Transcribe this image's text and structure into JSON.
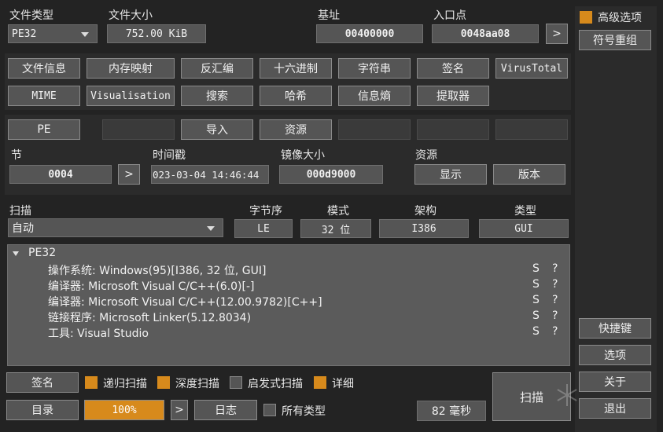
{
  "header": {
    "file_type_label": "文件类型",
    "file_type_value": "PE32",
    "file_size_label": "文件大小",
    "file_size_value": "752.00 KiB",
    "base_label": "基址",
    "base_value": "00400000",
    "entry_label": "入口点",
    "entry_value": "0048aa08",
    "entry_btn": ">"
  },
  "right": {
    "advanced_label": "高级选项",
    "symbol_rename": "符号重组",
    "shortcuts": "快捷键",
    "options": "选项",
    "about": "关于",
    "exit": "退出"
  },
  "tools": {
    "row1": [
      "文件信息",
      "内存映射",
      "反汇编",
      "十六进制",
      "字符串",
      "签名",
      "VirusTotal"
    ],
    "row2": [
      "MIME",
      "Visualisation",
      "搜索",
      "哈希",
      "信息熵",
      "提取器"
    ]
  },
  "pe": {
    "pe_btn": "PE",
    "import_btn": "导入",
    "resource_btn": "资源",
    "section_label": "节",
    "section_value": "0004",
    "section_btn": ">",
    "timestamp_label": "时间戳",
    "timestamp_value": "023-03-04 14:46:44",
    "image_size_label": "镜像大小",
    "image_size_value": "000d9000",
    "resource_label": "资源",
    "show_btn": "显示",
    "version_btn": "版本"
  },
  "scan": {
    "scan_label": "扫描",
    "scan_value": "自动",
    "endian_label": "字节序",
    "endian_value": "LE",
    "mode_label": "模式",
    "mode_value": "32 位",
    "arch_label": "架构",
    "arch_value": "I386",
    "type_label": "类型",
    "type_value": "GUI"
  },
  "results": {
    "root": "PE32",
    "items": [
      {
        "text": "操作系统: Windows(95)[I386, 32 位, GUI]",
        "s": "S",
        "q": "?"
      },
      {
        "text": "编译器: Microsoft Visual C/C++(6.0)[-]",
        "s": "S",
        "q": "?"
      },
      {
        "text": "编译器: Microsoft Visual C/C++(12.00.9782)[C++]",
        "s": "S",
        "q": "?"
      },
      {
        "text": "链接程序: Microsoft Linker(5.12.8034)",
        "s": "S",
        "q": "?"
      },
      {
        "text": "工具: Visual Studio",
        "s": "S",
        "q": "?"
      }
    ]
  },
  "bottom": {
    "signature_btn": "签名",
    "recursive_label": "递归扫描",
    "deep_label": "深度扫描",
    "heuristic_label": "启发式扫描",
    "verbose_label": "详细",
    "dir_btn": "目录",
    "progress_value": "100%",
    "progress_fraction": 1.0,
    "progress_btn": ">",
    "log_btn": "日志",
    "all_types_label": "所有类型",
    "time_value": "82 毫秒",
    "scan_btn": "扫描"
  },
  "colors": {
    "accent": "#d78a1c",
    "background": "#232323",
    "field": "#555555"
  },
  "icons": {
    "dropdown": "chevron-down-icon",
    "tree_toggle": "triangle-down-icon",
    "watermark": "snowflake-icon"
  }
}
